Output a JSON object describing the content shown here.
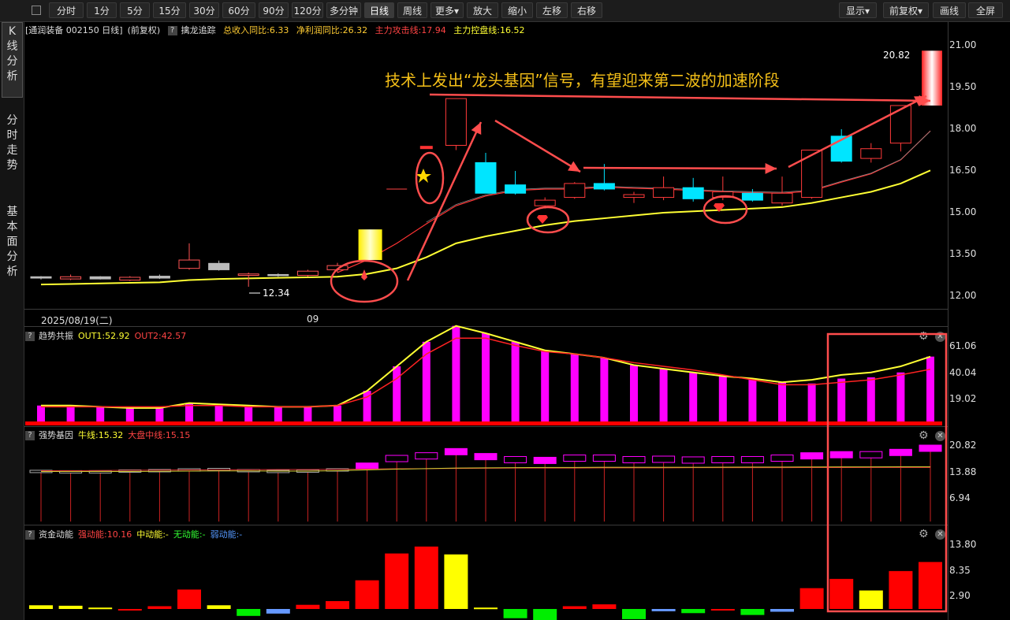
{
  "toolbar": {
    "periods": [
      "分时",
      "1分",
      "5分",
      "15分",
      "30分",
      "60分",
      "90分",
      "120分",
      "多分钟",
      "日线",
      "周线",
      "更多▾",
      "放大",
      "缩小",
      "左移",
      "右移"
    ],
    "right": [
      "显示▾",
      "前复权▾",
      "画线",
      "全屏"
    ]
  },
  "sidebar": [
    {
      "label": [
        "K",
        "线",
        "分",
        "析"
      ]
    },
    {
      "label": [
        "分",
        "时",
        "走",
        "势"
      ]
    },
    {
      "label": [
        "基",
        "本",
        "面",
        "分",
        "析"
      ]
    }
  ],
  "main_header": {
    "stock": "[通润装备 002150 日线]",
    "adj": "(前复权)",
    "indicator": "擒龙追踪",
    "rev": "总收入同比:6.33",
    "profit": "净利润同比:26.32",
    "attack": "主力攻击线:17.94",
    "control": "主力控盘线:16.52"
  },
  "main_axis": [
    "21.00",
    "19.50",
    "18.00",
    "16.50",
    "15.00",
    "13.50",
    "12.00"
  ],
  "annotation": "技术上发出“龙头基因”信号，有望迎来第二波的加速阶段",
  "price_high_label": "20.82",
  "price_low_label": "12.34",
  "date_label": "2025/08/19(二)",
  "month_label": "09",
  "trend": {
    "name": "趋势共振",
    "out1": "OUT1:52.92",
    "out2": "OUT2:42.57",
    "axis": [
      "61.06",
      "40.04",
      "19.02"
    ]
  },
  "gene": {
    "name": "强势基因",
    "bull": "牛线:15.32",
    "market": "大盘中线:15.15",
    "axis": [
      "20.82",
      "13.88",
      "6.94"
    ]
  },
  "fund": {
    "name": "资金动能",
    "strong": "强动能:10.16",
    "mid": "中动能:-",
    "none": "无动能:-",
    "weak": "弱动能:-",
    "axis": [
      "13.80",
      "8.35",
      "2.90"
    ]
  },
  "colors": {
    "up": "#ff3a3a",
    "down": "#00e5ff",
    "ma_yellow": "#ffff33",
    "magenta": "#ff00ff",
    "gold": "#f5c018"
  },
  "chart_data": {
    "type": "candlestick",
    "ylim": [
      12.0,
      21.0
    ],
    "candles": [
      {
        "o": 12.7,
        "h": 12.72,
        "l": 12.6,
        "c": 12.65
      },
      {
        "o": 12.62,
        "h": 12.78,
        "l": 12.58,
        "c": 12.7
      },
      {
        "o": 12.7,
        "h": 12.72,
        "l": 12.6,
        "c": 12.62
      },
      {
        "o": 12.58,
        "h": 12.72,
        "l": 12.55,
        "c": 12.68
      },
      {
        "o": 12.72,
        "h": 12.78,
        "l": 12.62,
        "c": 12.65
      },
      {
        "o": 13.0,
        "h": 13.9,
        "l": 12.95,
        "c": 13.3
      },
      {
        "o": 13.18,
        "h": 13.28,
        "l": 12.92,
        "c": 12.95
      },
      {
        "o": 12.75,
        "h": 12.85,
        "l": 12.34,
        "c": 12.8
      },
      {
        "o": 12.78,
        "h": 12.82,
        "l": 12.7,
        "c": 12.74
      },
      {
        "o": 12.75,
        "h": 12.95,
        "l": 12.7,
        "c": 12.9
      },
      {
        "o": 12.95,
        "h": 13.2,
        "l": 12.85,
        "c": 13.1
      },
      {
        "o": 13.3,
        "h": 14.4,
        "l": 13.25,
        "c": 14.4
      },
      {
        "o": 15.85,
        "h": 15.85,
        "l": 15.85,
        "c": 15.85
      },
      {
        "o": 17.3,
        "h": 17.42,
        "l": 17.22,
        "c": 17.35
      },
      {
        "o": 17.42,
        "h": 19.1,
        "l": 17.25,
        "c": 19.1
      },
      {
        "o": 16.8,
        "h": 17.15,
        "l": 15.7,
        "c": 15.7
      },
      {
        "o": 16.0,
        "h": 16.5,
        "l": 15.65,
        "c": 15.7
      },
      {
        "o": 15.25,
        "h": 15.55,
        "l": 15.15,
        "c": 15.45
      },
      {
        "o": 15.55,
        "h": 16.1,
        "l": 15.5,
        "c": 16.05
      },
      {
        "o": 16.05,
        "h": 16.75,
        "l": 15.8,
        "c": 15.85
      },
      {
        "o": 15.55,
        "h": 15.75,
        "l": 15.35,
        "c": 15.65
      },
      {
        "o": 15.55,
        "h": 16.3,
        "l": 15.45,
        "c": 15.9
      },
      {
        "o": 15.9,
        "h": 16.25,
        "l": 15.4,
        "c": 15.5
      },
      {
        "o": 15.55,
        "h": 16.3,
        "l": 15.45,
        "c": 15.75
      },
      {
        "o": 15.7,
        "h": 15.85,
        "l": 15.4,
        "c": 15.45
      },
      {
        "o": 15.35,
        "h": 16.3,
        "l": 15.25,
        "c": 15.7
      },
      {
        "o": 15.55,
        "h": 17.25,
        "l": 15.5,
        "c": 17.25
      },
      {
        "o": 17.75,
        "h": 18.0,
        "l": 16.8,
        "c": 16.85
      },
      {
        "o": 16.95,
        "h": 17.5,
        "l": 16.8,
        "c": 17.3
      },
      {
        "o": 17.5,
        "h": 18.5,
        "l": 17.2,
        "c": 18.85
      },
      {
        "o": 18.85,
        "h": 20.82,
        "l": 18.85,
        "c": 20.82
      }
    ],
    "ma_fast": [
      null,
      null,
      null,
      null,
      null,
      null,
      null,
      null,
      null,
      null,
      12.85,
      13.3,
      13.9,
      14.6,
      15.25,
      15.6,
      15.8,
      15.85,
      15.85,
      15.92,
      15.88,
      15.85,
      15.8,
      15.75,
      15.72,
      15.7,
      15.78,
      16.1,
      16.4,
      16.9,
      17.94
    ],
    "ma_slow": [
      12.42,
      12.44,
      12.46,
      12.48,
      12.5,
      12.58,
      12.62,
      12.64,
      12.66,
      12.68,
      12.7,
      12.8,
      13.0,
      13.4,
      13.9,
      14.15,
      14.35,
      14.55,
      14.7,
      14.8,
      14.9,
      15.0,
      15.05,
      15.1,
      15.15,
      15.2,
      15.35,
      15.55,
      15.75,
      16.05,
      16.52
    ],
    "trend_bars": [
      13,
      13,
      12,
      11,
      11,
      15,
      14,
      13,
      12,
      12,
      13,
      25,
      45,
      65,
      78,
      72,
      65,
      58,
      55,
      52,
      46,
      43,
      40,
      37,
      35,
      32,
      31,
      35,
      36,
      40,
      52.92
    ],
    "trend_out1": [
      13,
      13,
      12,
      11,
      11,
      15,
      14,
      13,
      12,
      12,
      13,
      25,
      45,
      65,
      78,
      72,
      65,
      58,
      55,
      52,
      46,
      43,
      40,
      37,
      35,
      32,
      34,
      38,
      40,
      45,
      52.92
    ],
    "trend_out2": [
      12,
      12,
      12,
      12,
      12,
      13,
      13,
      12,
      12,
      12,
      13,
      20,
      35,
      55,
      68,
      68,
      62,
      57,
      55,
      52,
      48,
      45,
      42,
      38,
      34,
      30,
      30,
      32,
      34,
      38,
      42.57
    ],
    "gene_bars": [
      14.1,
      14.0,
      14.0,
      14.2,
      14.3,
      14.5,
      14.6,
      14.3,
      14.1,
      14.2,
      14.5,
      15.5,
      17.5,
      18.2,
      19.3,
      18.0,
      17.2,
      17.0,
      17.6,
      17.6,
      17.2,
      17.3,
      17.1,
      17.2,
      17.2,
      17.6,
      18.2,
      18.5,
      18.5,
      19.1,
      20.2
    ],
    "gene_bull": [
      14.1,
      14.1,
      14.1,
      14.1,
      14.15,
      14.2,
      14.25,
      14.25,
      14.2,
      14.2,
      14.3,
      14.5,
      14.7,
      14.85,
      15.0,
      15.05,
      15.1,
      15.15,
      15.15,
      15.2,
      15.2,
      15.2,
      15.2,
      15.22,
      15.25,
      15.25,
      15.28,
      15.3,
      15.3,
      15.32,
      15.32
    ],
    "gene_market": [
      14.3,
      14.3,
      14.35,
      14.4,
      14.45,
      14.5,
      14.55,
      14.55,
      14.6,
      14.6,
      14.65,
      14.7,
      14.8,
      14.85,
      14.9,
      14.95,
      15.0,
      15.0,
      15.0,
      15.05,
      15.05,
      15.05,
      15.1,
      15.1,
      15.1,
      15.1,
      15.12,
      15.13,
      15.14,
      15.15,
      15.15
    ],
    "fund_bars": [
      {
        "v": 0.8,
        "c": "yellow"
      },
      {
        "v": 0.7,
        "c": "yellow"
      },
      {
        "v": 0.3,
        "c": "yellow"
      },
      {
        "v": -0.2,
        "c": "red"
      },
      {
        "v": 0.6,
        "c": "red"
      },
      {
        "v": 4.2,
        "c": "red"
      },
      {
        "v": 0.8,
        "c": "yellow"
      },
      {
        "v": -1.5,
        "c": "green"
      },
      {
        "v": -1.0,
        "c": "blue"
      },
      {
        "v": 0.9,
        "c": "red"
      },
      {
        "v": 1.7,
        "c": "red"
      },
      {
        "v": 6.2,
        "c": "red"
      },
      {
        "v": 12.0,
        "c": "red"
      },
      {
        "v": 13.5,
        "c": "red"
      },
      {
        "v": 11.8,
        "c": "yellow"
      },
      {
        "v": 0.3,
        "c": "yellow"
      },
      {
        "v": -2.0,
        "c": "green"
      },
      {
        "v": -3.0,
        "c": "green"
      },
      {
        "v": 0.6,
        "c": "red"
      },
      {
        "v": 1.0,
        "c": "red"
      },
      {
        "v": -2.2,
        "c": "green"
      },
      {
        "v": -0.5,
        "c": "blue"
      },
      {
        "v": -0.9,
        "c": "green"
      },
      {
        "v": -0.3,
        "c": "red"
      },
      {
        "v": -1.3,
        "c": "green"
      },
      {
        "v": -0.6,
        "c": "blue"
      },
      {
        "v": 4.5,
        "c": "red"
      },
      {
        "v": 6.5,
        "c": "red"
      },
      {
        "v": 4.0,
        "c": "yellow"
      },
      {
        "v": 8.2,
        "c": "red"
      },
      {
        "v": 10.16,
        "c": "red"
      }
    ]
  }
}
